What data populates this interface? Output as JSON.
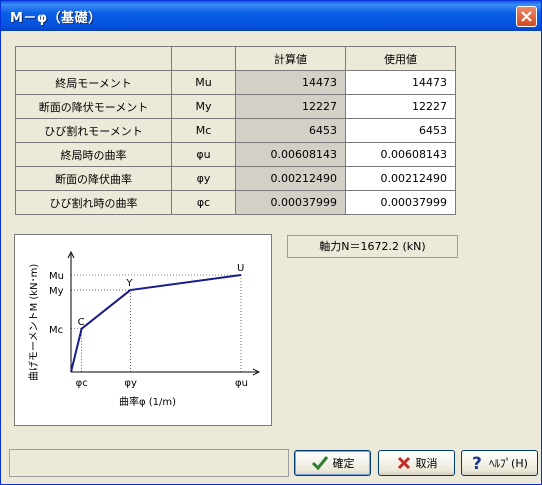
{
  "window": {
    "title": "M－φ（基礎）"
  },
  "table": {
    "headers": {
      "label": "",
      "symbol": "",
      "calc": "計算値",
      "use": "使用値"
    },
    "rows": [
      {
        "label": "終局モーメント",
        "symbol": "Mu",
        "calc": "14473",
        "use": "14473"
      },
      {
        "label": "断面の降伏モーメント",
        "symbol": "My",
        "calc": "12227",
        "use": "12227"
      },
      {
        "label": "ひび割れモーメント",
        "symbol": "Mc",
        "calc": "6453",
        "use": "6453"
      },
      {
        "label": "終局時の曲率",
        "symbol": "φu",
        "calc": "0.00608143",
        "use": "0.00608143"
      },
      {
        "label": "断面の降伏曲率",
        "symbol": "φy",
        "calc": "0.00212490",
        "use": "0.00212490"
      },
      {
        "label": "ひび割れ時の曲率",
        "symbol": "φc",
        "calc": "0.00037999",
        "use": "0.00037999"
      }
    ]
  },
  "axial_force": "軸力N＝1672.2 (kN)",
  "chart_data": {
    "type": "line",
    "title": "",
    "xlabel": "曲率φ (1/m)",
    "ylabel": "曲げモーメントM (kN･m)",
    "x_ticks": [
      "φc",
      "φy",
      "φu"
    ],
    "y_ticks": [
      "Mc",
      "My",
      "Mu"
    ],
    "points_labels": [
      "C",
      "Y",
      "U"
    ],
    "series": [
      {
        "x": [
          0,
          0.00037999,
          0.0021249,
          0.00608143
        ],
        "y": [
          0,
          6453,
          12227,
          14473
        ]
      }
    ],
    "line_color": "#1a1a8c"
  },
  "buttons": {
    "ok": "確定",
    "cancel": "取消",
    "help": "ﾍﾙﾌﾟ(H)"
  },
  "colors": {
    "ok_icon": "#2e7d32",
    "cancel_icon": "#c62828",
    "help_icon": "#1a3a8c"
  }
}
